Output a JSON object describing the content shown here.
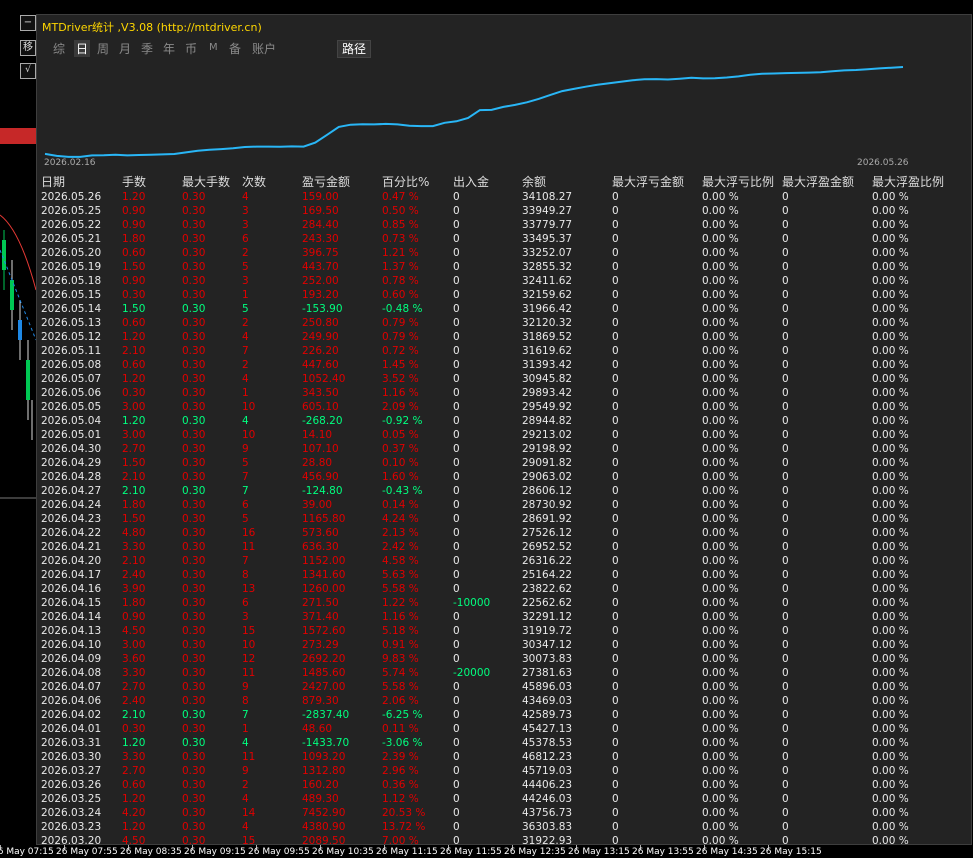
{
  "window": {
    "title": "MTDriver统计 ,V3.08 (http://mtdriver.cn)"
  },
  "left_buttons": {
    "collapse": "−",
    "move": "移",
    "check": "√"
  },
  "tabs": [
    "综",
    "日",
    "周",
    "月",
    "季",
    "年",
    "币",
    "M",
    "备",
    "账户"
  ],
  "active_tab": "日",
  "path_button": "路径",
  "equity_chart": {
    "start_date": "2026.02.16",
    "end_date": "2026.05.26",
    "line_color": "#29b6f6"
  },
  "chart_data": {
    "type": "line",
    "x_start": "2026.02.16",
    "x_end": "2026.05.26",
    "values": [
      4.5,
      3.0,
      2.3,
      2.3,
      3.4,
      3.5,
      3.8,
      3.4,
      3.7,
      3.9,
      4.1,
      4.4,
      5.6,
      6.8,
      7.6,
      8.0,
      8.6,
      9.6,
      9.9,
      9.9,
      9.8,
      10.0,
      9.9,
      12.8,
      18.6,
      24.4,
      26.0,
      26.3,
      26.2,
      26.6,
      26.2,
      25.3,
      25.0,
      25.0,
      27.4,
      28.5,
      31.0,
      36.8,
      36.9,
      39.1,
      40.6,
      42.5,
      45.0,
      48.0,
      50.8,
      52.4,
      54.0,
      55.4,
      56.6,
      57.6,
      58.8,
      59.5,
      59.6,
      59.3,
      59.9,
      60.6,
      60.1,
      60.3,
      60.8,
      61.6,
      62.8,
      63.5,
      63.7,
      64.0,
      64.2,
      64.4,
      64.6,
      65.4,
      66.0,
      66.3,
      66.9,
      67.5,
      68.0,
      68.5
    ]
  },
  "table": {
    "headers": [
      "日期",
      "手数",
      "最大手数",
      "次数",
      "盈亏金额",
      "百分比%",
      "出入金",
      "余额",
      "最大浮亏金额",
      "最大浮亏比例",
      "最大浮盈金额",
      "最大浮盈比例"
    ],
    "rows": [
      [
        "2026.05.26",
        "1.20",
        "0.30",
        "4",
        "159.00",
        "0.47 %",
        "0",
        "34108.27",
        "0",
        "0.00 %",
        "0",
        "0.00 %"
      ],
      [
        "2026.05.25",
        "0.90",
        "0.30",
        "3",
        "169.50",
        "0.50 %",
        "0",
        "33949.27",
        "0",
        "0.00 %",
        "0",
        "0.00 %"
      ],
      [
        "2026.05.22",
        "0.90",
        "0.30",
        "3",
        "284.40",
        "0.85 %",
        "0",
        "33779.77",
        "0",
        "0.00 %",
        "0",
        "0.00 %"
      ],
      [
        "2026.05.21",
        "1.80",
        "0.30",
        "6",
        "243.30",
        "0.73 %",
        "0",
        "33495.37",
        "0",
        "0.00 %",
        "0",
        "0.00 %"
      ],
      [
        "2026.05.20",
        "0.60",
        "0.30",
        "2",
        "396.75",
        "1.21 %",
        "0",
        "33252.07",
        "0",
        "0.00 %",
        "0",
        "0.00 %"
      ],
      [
        "2026.05.19",
        "1.50",
        "0.30",
        "5",
        "443.70",
        "1.37 %",
        "0",
        "32855.32",
        "0",
        "0.00 %",
        "0",
        "0.00 %"
      ],
      [
        "2026.05.18",
        "0.90",
        "0.30",
        "3",
        "252.00",
        "0.78 %",
        "0",
        "32411.62",
        "0",
        "0.00 %",
        "0",
        "0.00 %"
      ],
      [
        "2026.05.15",
        "0.30",
        "0.30",
        "1",
        "193.20",
        "0.60 %",
        "0",
        "32159.62",
        "0",
        "0.00 %",
        "0",
        "0.00 %"
      ],
      [
        "2026.05.14",
        "1.50",
        "0.30",
        "5",
        "-153.90",
        "-0.48 %",
        "0",
        "31966.42",
        "0",
        "0.00 %",
        "0",
        "0.00 %"
      ],
      [
        "2026.05.13",
        "0.60",
        "0.30",
        "2",
        "250.80",
        "0.79 %",
        "0",
        "32120.32",
        "0",
        "0.00 %",
        "0",
        "0.00 %"
      ],
      [
        "2026.05.12",
        "1.20",
        "0.30",
        "4",
        "249.90",
        "0.79 %",
        "0",
        "31869.52",
        "0",
        "0.00 %",
        "0",
        "0.00 %"
      ],
      [
        "2026.05.11",
        "2.10",
        "0.30",
        "7",
        "226.20",
        "0.72 %",
        "0",
        "31619.62",
        "0",
        "0.00 %",
        "0",
        "0.00 %"
      ],
      [
        "2026.05.08",
        "0.60",
        "0.30",
        "2",
        "447.60",
        "1.45 %",
        "0",
        "31393.42",
        "0",
        "0.00 %",
        "0",
        "0.00 %"
      ],
      [
        "2026.05.07",
        "1.20",
        "0.30",
        "4",
        "1052.40",
        "3.52 %",
        "0",
        "30945.82",
        "0",
        "0.00 %",
        "0",
        "0.00 %"
      ],
      [
        "2026.05.06",
        "0.30",
        "0.30",
        "1",
        "343.50",
        "1.16 %",
        "0",
        "29893.42",
        "0",
        "0.00 %",
        "0",
        "0.00 %"
      ],
      [
        "2026.05.05",
        "3.00",
        "0.30",
        "10",
        "605.10",
        "2.09 %",
        "0",
        "29549.92",
        "0",
        "0.00 %",
        "0",
        "0.00 %"
      ],
      [
        "2026.05.04",
        "1.20",
        "0.30",
        "4",
        "-268.20",
        "-0.92 %",
        "0",
        "28944.82",
        "0",
        "0.00 %",
        "0",
        "0.00 %"
      ],
      [
        "2026.05.01",
        "3.00",
        "0.30",
        "10",
        "14.10",
        "0.05 %",
        "0",
        "29213.02",
        "0",
        "0.00 %",
        "0",
        "0.00 %"
      ],
      [
        "2026.04.30",
        "2.70",
        "0.30",
        "9",
        "107.10",
        "0.37 %",
        "0",
        "29198.92",
        "0",
        "0.00 %",
        "0",
        "0.00 %"
      ],
      [
        "2026.04.29",
        "1.50",
        "0.30",
        "5",
        "28.80",
        "0.10 %",
        "0",
        "29091.82",
        "0",
        "0.00 %",
        "0",
        "0.00 %"
      ],
      [
        "2026.04.28",
        "2.10",
        "0.30",
        "7",
        "456.90",
        "1.60 %",
        "0",
        "29063.02",
        "0",
        "0.00 %",
        "0",
        "0.00 %"
      ],
      [
        "2026.04.27",
        "2.10",
        "0.30",
        "7",
        "-124.80",
        "-0.43 %",
        "0",
        "28606.12",
        "0",
        "0.00 %",
        "0",
        "0.00 %"
      ],
      [
        "2026.04.24",
        "1.80",
        "0.30",
        "6",
        "39.00",
        "0.14 %",
        "0",
        "28730.92",
        "0",
        "0.00 %",
        "0",
        "0.00 %"
      ],
      [
        "2026.04.23",
        "1.50",
        "0.30",
        "5",
        "1165.80",
        "4.24 %",
        "0",
        "28691.92",
        "0",
        "0.00 %",
        "0",
        "0.00 %"
      ],
      [
        "2026.04.22",
        "4.80",
        "0.30",
        "16",
        "573.60",
        "2.13 %",
        "0",
        "27526.12",
        "0",
        "0.00 %",
        "0",
        "0.00 %"
      ],
      [
        "2026.04.21",
        "3.30",
        "0.30",
        "11",
        "636.30",
        "2.42 %",
        "0",
        "26952.52",
        "0",
        "0.00 %",
        "0",
        "0.00 %"
      ],
      [
        "2026.04.20",
        "2.10",
        "0.30",
        "7",
        "1152.00",
        "4.58 %",
        "0",
        "26316.22",
        "0",
        "0.00 %",
        "0",
        "0.00 %"
      ],
      [
        "2026.04.17",
        "2.40",
        "0.30",
        "8",
        "1341.60",
        "5.63 %",
        "0",
        "25164.22",
        "0",
        "0.00 %",
        "0",
        "0.00 %"
      ],
      [
        "2026.04.16",
        "3.90",
        "0.30",
        "13",
        "1260.00",
        "5.58 %",
        "0",
        "23822.62",
        "0",
        "0.00 %",
        "0",
        "0.00 %"
      ],
      [
        "2026.04.15",
        "1.80",
        "0.30",
        "6",
        "271.50",
        "1.22 %",
        "-10000",
        "22562.62",
        "0",
        "0.00 %",
        "0",
        "0.00 %"
      ],
      [
        "2026.04.14",
        "0.90",
        "0.30",
        "3",
        "371.40",
        "1.16 %",
        "0",
        "32291.12",
        "0",
        "0.00 %",
        "0",
        "0.00 %"
      ],
      [
        "2026.04.13",
        "4.50",
        "0.30",
        "15",
        "1572.60",
        "5.18 %",
        "0",
        "31919.72",
        "0",
        "0.00 %",
        "0",
        "0.00 %"
      ],
      [
        "2026.04.10",
        "3.00",
        "0.30",
        "10",
        "273.29",
        "0.91 %",
        "0",
        "30347.12",
        "0",
        "0.00 %",
        "0",
        "0.00 %"
      ],
      [
        "2026.04.09",
        "3.60",
        "0.30",
        "12",
        "2692.20",
        "9.83 %",
        "0",
        "30073.83",
        "0",
        "0.00 %",
        "0",
        "0.00 %"
      ],
      [
        "2026.04.08",
        "3.30",
        "0.30",
        "11",
        "1485.60",
        "5.74 %",
        "-20000",
        "27381.63",
        "0",
        "0.00 %",
        "0",
        "0.00 %"
      ],
      [
        "2026.04.07",
        "2.70",
        "0.30",
        "9",
        "2427.00",
        "5.58 %",
        "0",
        "45896.03",
        "0",
        "0.00 %",
        "0",
        "0.00 %"
      ],
      [
        "2026.04.06",
        "2.40",
        "0.30",
        "8",
        "879.30",
        "2.06 %",
        "0",
        "43469.03",
        "0",
        "0.00 %",
        "0",
        "0.00 %"
      ],
      [
        "2026.04.02",
        "2.10",
        "0.30",
        "7",
        "-2837.40",
        "-6.25 %",
        "0",
        "42589.73",
        "0",
        "0.00 %",
        "0",
        "0.00 %"
      ],
      [
        "2026.04.01",
        "0.30",
        "0.30",
        "1",
        "48.60",
        "0.11 %",
        "0",
        "45427.13",
        "0",
        "0.00 %",
        "0",
        "0.00 %"
      ],
      [
        "2026.03.31",
        "1.20",
        "0.30",
        "4",
        "-1433.70",
        "-3.06 %",
        "0",
        "45378.53",
        "0",
        "0.00 %",
        "0",
        "0.00 %"
      ],
      [
        "2026.03.30",
        "3.30",
        "0.30",
        "11",
        "1093.20",
        "2.39 %",
        "0",
        "46812.23",
        "0",
        "0.00 %",
        "0",
        "0.00 %"
      ],
      [
        "2026.03.27",
        "2.70",
        "0.30",
        "9",
        "1312.80",
        "2.96 %",
        "0",
        "45719.03",
        "0",
        "0.00 %",
        "0",
        "0.00 %"
      ],
      [
        "2026.03.26",
        "0.60",
        "0.30",
        "2",
        "160.20",
        "0.36 %",
        "0",
        "44406.23",
        "0",
        "0.00 %",
        "0",
        "0.00 %"
      ],
      [
        "2026.03.25",
        "1.20",
        "0.30",
        "4",
        "489.30",
        "1.12 %",
        "0",
        "44246.03",
        "0",
        "0.00 %",
        "0",
        "0.00 %"
      ],
      [
        "2026.03.24",
        "4.20",
        "0.30",
        "14",
        "7452.90",
        "20.53 %",
        "0",
        "43756.73",
        "0",
        "0.00 %",
        "0",
        "0.00 %"
      ],
      [
        "2026.03.23",
        "1.20",
        "0.30",
        "4",
        "4380.90",
        "13.72 %",
        "0",
        "36303.83",
        "0",
        "0.00 %",
        "0",
        "0.00 %"
      ],
      [
        "2026.03.20",
        "4.50",
        "0.30",
        "15",
        "2089.50",
        "7.00 %",
        "0",
        "31922.93",
        "0",
        "0.00 %",
        "0",
        "0.00 %"
      ]
    ]
  },
  "time_axis": [
    "26 May 07:15",
    "26 May 07:55",
    "26 May 08:35",
    "26 May 09:15",
    "26 May 09:55",
    "26 May 10:35",
    "26 May 11:15",
    "26 May 11:55",
    "26 May 12:35",
    "26 May 13:15",
    "26 May 13:55",
    "26 May 14:35",
    "26 May 15:15"
  ],
  "colors": {
    "title": "#ffd700",
    "gain": "#e00000",
    "loss": "#00ff7f",
    "equity": "#29b6f6",
    "panel": "#232323"
  }
}
